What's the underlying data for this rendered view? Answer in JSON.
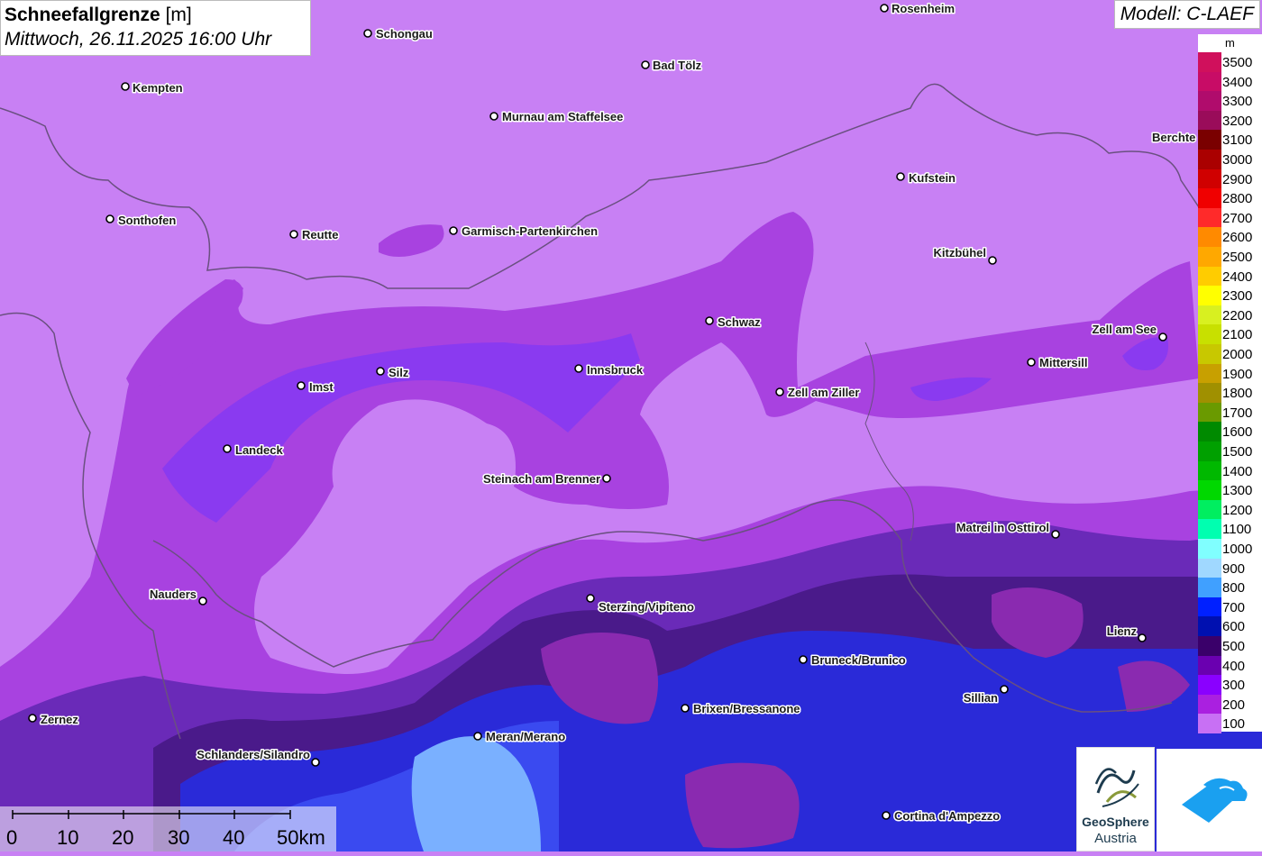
{
  "title": {
    "main_bold": "Schneefallgrenze",
    "main_unit": " [m]",
    "subtitle": "Mittwoch, 26.11.2025 16:00 Uhr"
  },
  "model": "Modell: C-LAEF",
  "legend": {
    "unit": "m",
    "entries": [
      {
        "label": "3500",
        "color": "#d0105c"
      },
      {
        "label": "3400",
        "color": "#c80c66"
      },
      {
        "label": "3300",
        "color": "#b00c6c"
      },
      {
        "label": "3200",
        "color": "#9a0c5a"
      },
      {
        "label": "3100",
        "color": "#7a0000"
      },
      {
        "label": "3000",
        "color": "#aa0000"
      },
      {
        "label": "2900",
        "color": "#d00000"
      },
      {
        "label": "2800",
        "color": "#f00000"
      },
      {
        "label": "2700",
        "color": "#ff2a2a"
      },
      {
        "label": "2600",
        "color": "#ff8a00"
      },
      {
        "label": "2500",
        "color": "#ffa800"
      },
      {
        "label": "2400",
        "color": "#ffcc00"
      },
      {
        "label": "2300",
        "color": "#ffff00"
      },
      {
        "label": "2200",
        "color": "#d8f020"
      },
      {
        "label": "2100",
        "color": "#c8e000"
      },
      {
        "label": "2000",
        "color": "#c8c800"
      },
      {
        "label": "1900",
        "color": "#c8a000"
      },
      {
        "label": "1800",
        "color": "#a09000"
      },
      {
        "label": "1700",
        "color": "#6a9a00"
      },
      {
        "label": "1600",
        "color": "#008a00"
      },
      {
        "label": "1500",
        "color": "#00a000"
      },
      {
        "label": "1400",
        "color": "#00b800"
      },
      {
        "label": "1300",
        "color": "#00d800"
      },
      {
        "label": "1200",
        "color": "#00ee60"
      },
      {
        "label": "1100",
        "color": "#00ffb0"
      },
      {
        "label": "1000",
        "color": "#80ffff"
      },
      {
        "label": "900",
        "color": "#a0d8ff"
      },
      {
        "label": "800",
        "color": "#40a0ff"
      },
      {
        "label": "700",
        "color": "#0020ff"
      },
      {
        "label": "600",
        "color": "#0010b0"
      },
      {
        "label": "500",
        "color": "#3a006a"
      },
      {
        "label": "400",
        "color": "#6a00b0"
      },
      {
        "label": "300",
        "color": "#8a00ff"
      },
      {
        "label": "200",
        "color": "#aa20e0"
      },
      {
        "label": "100",
        "color": "#c870f4"
      }
    ]
  },
  "cities": [
    {
      "name": "Rosenheim"
    },
    {
      "name": "Schongau"
    },
    {
      "name": "Bad Tölz"
    },
    {
      "name": "Kempten"
    },
    {
      "name": "Murnau am Staffelsee"
    },
    {
      "name": "Berchte"
    },
    {
      "name": "Kufstein"
    },
    {
      "name": "Sonthofen"
    },
    {
      "name": "Reutte"
    },
    {
      "name": "Garmisch-Partenkirchen"
    },
    {
      "name": "Kitzbühel"
    },
    {
      "name": "Schwaz"
    },
    {
      "name": "Zell am See"
    },
    {
      "name": "Mittersill"
    },
    {
      "name": "Imst"
    },
    {
      "name": "Silz"
    },
    {
      "name": "Innsbruck"
    },
    {
      "name": "Zell am Ziller"
    },
    {
      "name": "Landeck"
    },
    {
      "name": "Steinach am Brenner"
    },
    {
      "name": "Matrei in Osttirol"
    },
    {
      "name": "Nauders"
    },
    {
      "name": "Sterzing/Vipiteno"
    },
    {
      "name": "Lienz"
    },
    {
      "name": "Bruneck/Brunico"
    },
    {
      "name": "Sillian"
    },
    {
      "name": "Brixen/Bressanone"
    },
    {
      "name": "Zernez"
    },
    {
      "name": "Meran/Merano"
    },
    {
      "name": "Schlanders/Silandro"
    },
    {
      "name": "Cortina d'Ampezzo"
    }
  ],
  "scale": {
    "labels": [
      "0",
      "10",
      "20",
      "30",
      "40",
      "50km"
    ]
  },
  "logo": {
    "line1": "GeoSphere",
    "line2": "Austria"
  },
  "colors": {
    "base_violet": "#c880f4",
    "purple": "#a640e2",
    "blue": "#3a3af0",
    "navy": "#4a1a8a",
    "light_blue": "#a0d0ff"
  }
}
